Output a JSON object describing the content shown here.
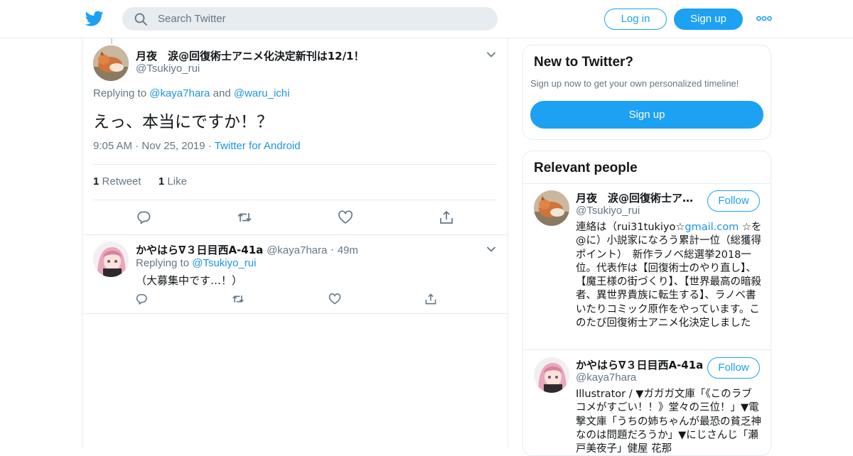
{
  "header": {
    "search_placeholder": "Search Twitter",
    "login_label": "Log in",
    "signup_label": "Sign up",
    "brand_color": "#1da1f2"
  },
  "main_tweet": {
    "author_name": "月夜　涙@回復術士アニメ化決定新刊は12/1！",
    "author_handle": "@Tsukiyo_rui",
    "replying_prefix": "Replying to ",
    "replying_to_1": "@kaya7hara",
    "replying_and": " and ",
    "replying_to_2": "@waru_ichi",
    "text": "えっ、本当にですか！？",
    "time": "9:05 AM",
    "date": "Nov 25, 2019",
    "source": "Twitter for Android",
    "retweet_count": "1",
    "retweet_label": "Retweet",
    "like_count": "1",
    "like_label": "Like"
  },
  "reply_tweet": {
    "author_name": "かやはら∇３日目西A-41a",
    "author_handle": "@kaya7hara",
    "time_ago": "49m",
    "replying_prefix": "Replying to ",
    "replying_to": "@Tsukiyo_rui",
    "text": "（大募集中です…！）"
  },
  "new_to_twitter": {
    "title": "New to Twitter?",
    "subtitle": "Sign up now to get your own personalized timeline!",
    "signup_label": "Sign up"
  },
  "relevant_people": {
    "title": "Relevant people",
    "follow_label": "Follow",
    "people": [
      {
        "name": "月夜　涙@回復術士ア…",
        "handle": "@Tsukiyo_rui",
        "bio_part1": "連絡は（rui31tukiyo☆",
        "bio_link": "gmail.com",
        "bio_part2": " ☆を@に）小説家になろう累計一位（総獲得ポイント）　新作ラノベ総選挙2018一位。代表作は【回復術士のやり直し】、【魔王様の街づくり】、【世界最高の暗殺者、異世界貴族に転生する】、ラノベ書いたりコミック原作をやっています。このたび回復術士アニメ化決定しました"
      },
      {
        "name": "かやはら∇３日目西A-41a",
        "handle": "@kaya7hara",
        "bio": "Illustrator / ▼ガガガ文庫「《このラブコメがすごい！！》堂々の三位！」▼電撃文庫「うちの姉ちゃんが最恐の貧乏神なのは問題だろうか」▼にじさんじ「瀬戸美夜子」健屋 花那"
      }
    ]
  }
}
